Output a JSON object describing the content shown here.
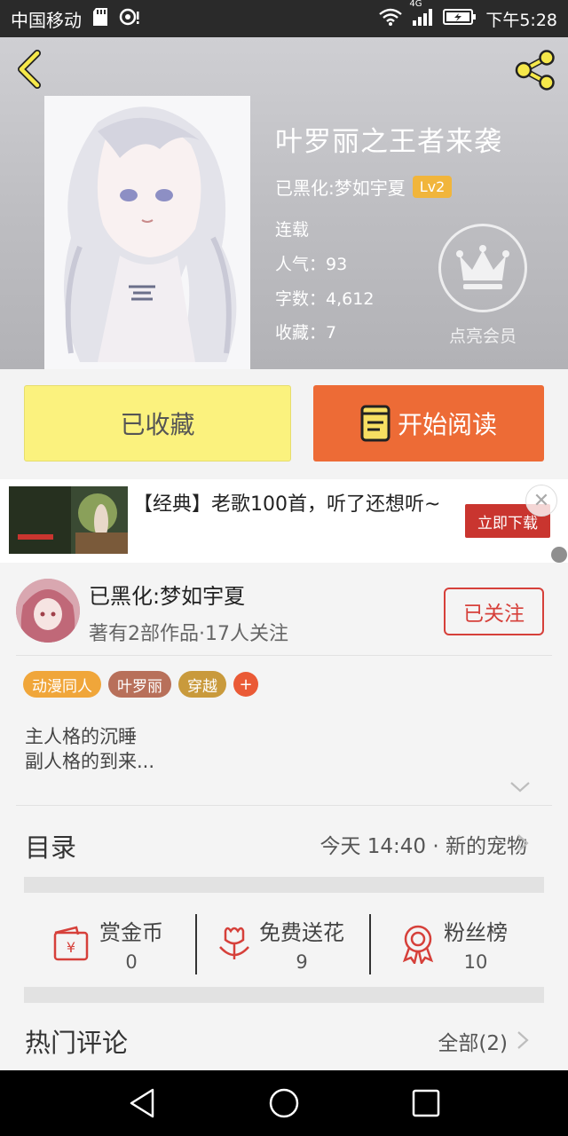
{
  "status_bar": {
    "carrier": "中国移动",
    "network": "4G",
    "time": "下午5:28"
  },
  "book": {
    "title": "叶罗丽之王者来袭",
    "author": "已黑化:梦如宇夏",
    "level": "Lv2",
    "status": "连载",
    "popularity_label": "人气：",
    "popularity": "93",
    "word_count_label": "字数：",
    "word_count": "4,612",
    "favorites_label": "收藏：",
    "favorites": "7",
    "vip_label": "点亮会员"
  },
  "actions": {
    "favorite_label": "已收藏",
    "read_label": "开始阅读"
  },
  "ad": {
    "text": "【经典】老歌100首，听了还想听~",
    "download_label": "立即下载"
  },
  "author_card": {
    "name": "已黑化:梦如宇夏",
    "subtitle": "著有2部作品·17人关注",
    "follow_label": "已关注"
  },
  "tags": [
    {
      "label": "动漫同人",
      "color": "#f0a63a"
    },
    {
      "label": "叶罗丽",
      "color": "#b8705a"
    },
    {
      "label": "穿越",
      "color": "#c99a3c"
    }
  ],
  "description": {
    "line1": "主人格的沉睡",
    "line2": "副人格的到来..."
  },
  "toc": {
    "label": "目录",
    "latest": "今天 14:40 · 新的宠物"
  },
  "stats": [
    {
      "label": "赏金币",
      "value": "0",
      "icon": "reward-coin-icon"
    },
    {
      "label": "免费送花",
      "value": "9",
      "icon": "flower-icon"
    },
    {
      "label": "粉丝榜",
      "value": "10",
      "icon": "ribbon-medal-icon"
    }
  ],
  "hot_comments": {
    "label": "热门评论",
    "all_label": "全部(2)"
  },
  "colors": {
    "accent_orange": "#ed6b36",
    "favorite_yellow": "#fbf27e",
    "follow_red": "#d6403a",
    "level_badge": "#f1b53b"
  }
}
